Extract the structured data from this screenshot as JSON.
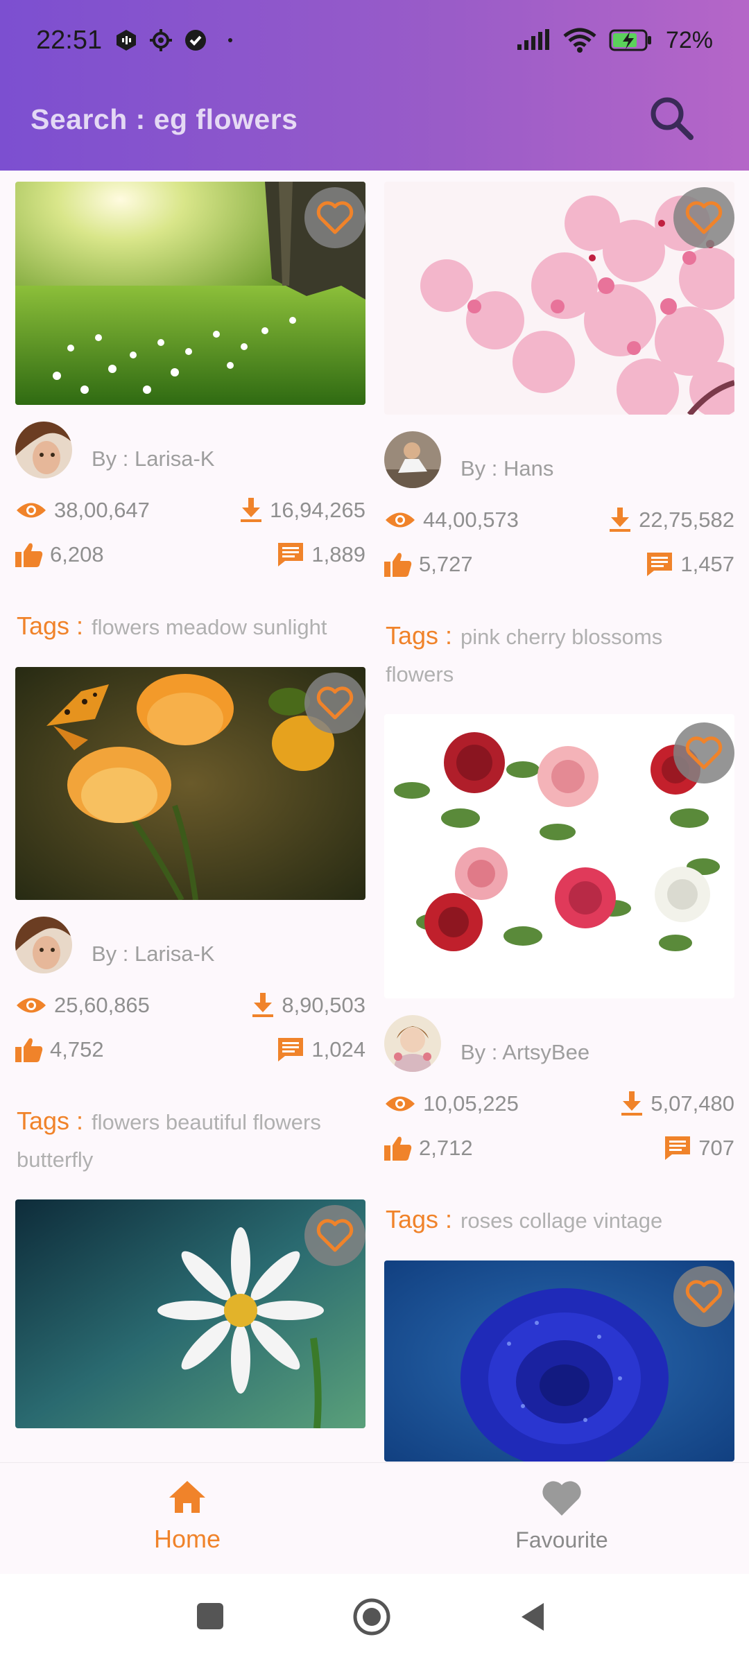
{
  "status_bar": {
    "time": "22:51",
    "battery": "72%"
  },
  "search": {
    "placeholder": "Search  : eg flowers"
  },
  "left_cards": [
    {
      "author": "By : Larisa-K",
      "views": "38,00,647",
      "downloads": "16,94,265",
      "likes": "6,208",
      "comments": "1,889",
      "tags_label": "Tags :",
      "tags": "flowers meadow sunlight",
      "image": "meadow"
    },
    {
      "author": "By : Larisa-K",
      "views": "25,60,865",
      "downloads": "8,90,503",
      "likes": "4,752",
      "comments": "1,024",
      "tags_label": "Tags :",
      "tags": "flowers beautiful flowers butterfly",
      "image": "orange-flowers"
    },
    {
      "image": "daisy"
    }
  ],
  "right_cards": [
    {
      "author": "By : Hans",
      "views": "44,00,573",
      "downloads": "22,75,582",
      "likes": "5,727",
      "comments": "1,457",
      "tags_label": "Tags :",
      "tags": "pink cherry blossoms flowers",
      "image": "cherry-blossom"
    },
    {
      "author": "By : ArtsyBee",
      "views": "10,05,225",
      "downloads": "5,07,480",
      "likes": "2,712",
      "comments": "707",
      "tags_label": "Tags :",
      "tags": "roses collage vintage",
      "image": "roses"
    },
    {
      "image": "blue-rose"
    }
  ],
  "bottom_nav": {
    "home": "Home",
    "favourite": "Favourite"
  },
  "colors": {
    "accent": "#f0832a",
    "header_start": "#7c4fd0",
    "header_end": "#b566c8"
  }
}
